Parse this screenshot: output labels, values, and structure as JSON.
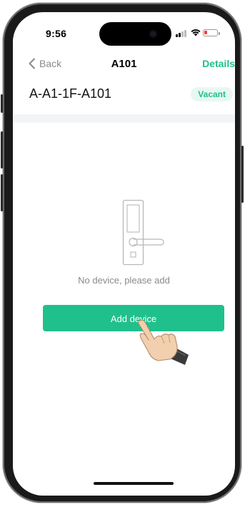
{
  "status_bar": {
    "time": "9:56",
    "battery_level": 0.2
  },
  "nav": {
    "back_label": "Back",
    "title": "A101",
    "details_label": "Details"
  },
  "room": {
    "name": "A-A1-1F-A101",
    "status": "Vacant"
  },
  "empty_state": {
    "message": "No device, please add",
    "icon": "door-lock-icon"
  },
  "actions": {
    "add_device_label": "Add device"
  },
  "colors": {
    "accent": "#20c08c",
    "badge_bg": "#e6f8f1",
    "muted_text": "#8a8a8a",
    "divider": "#f3f4f6"
  }
}
